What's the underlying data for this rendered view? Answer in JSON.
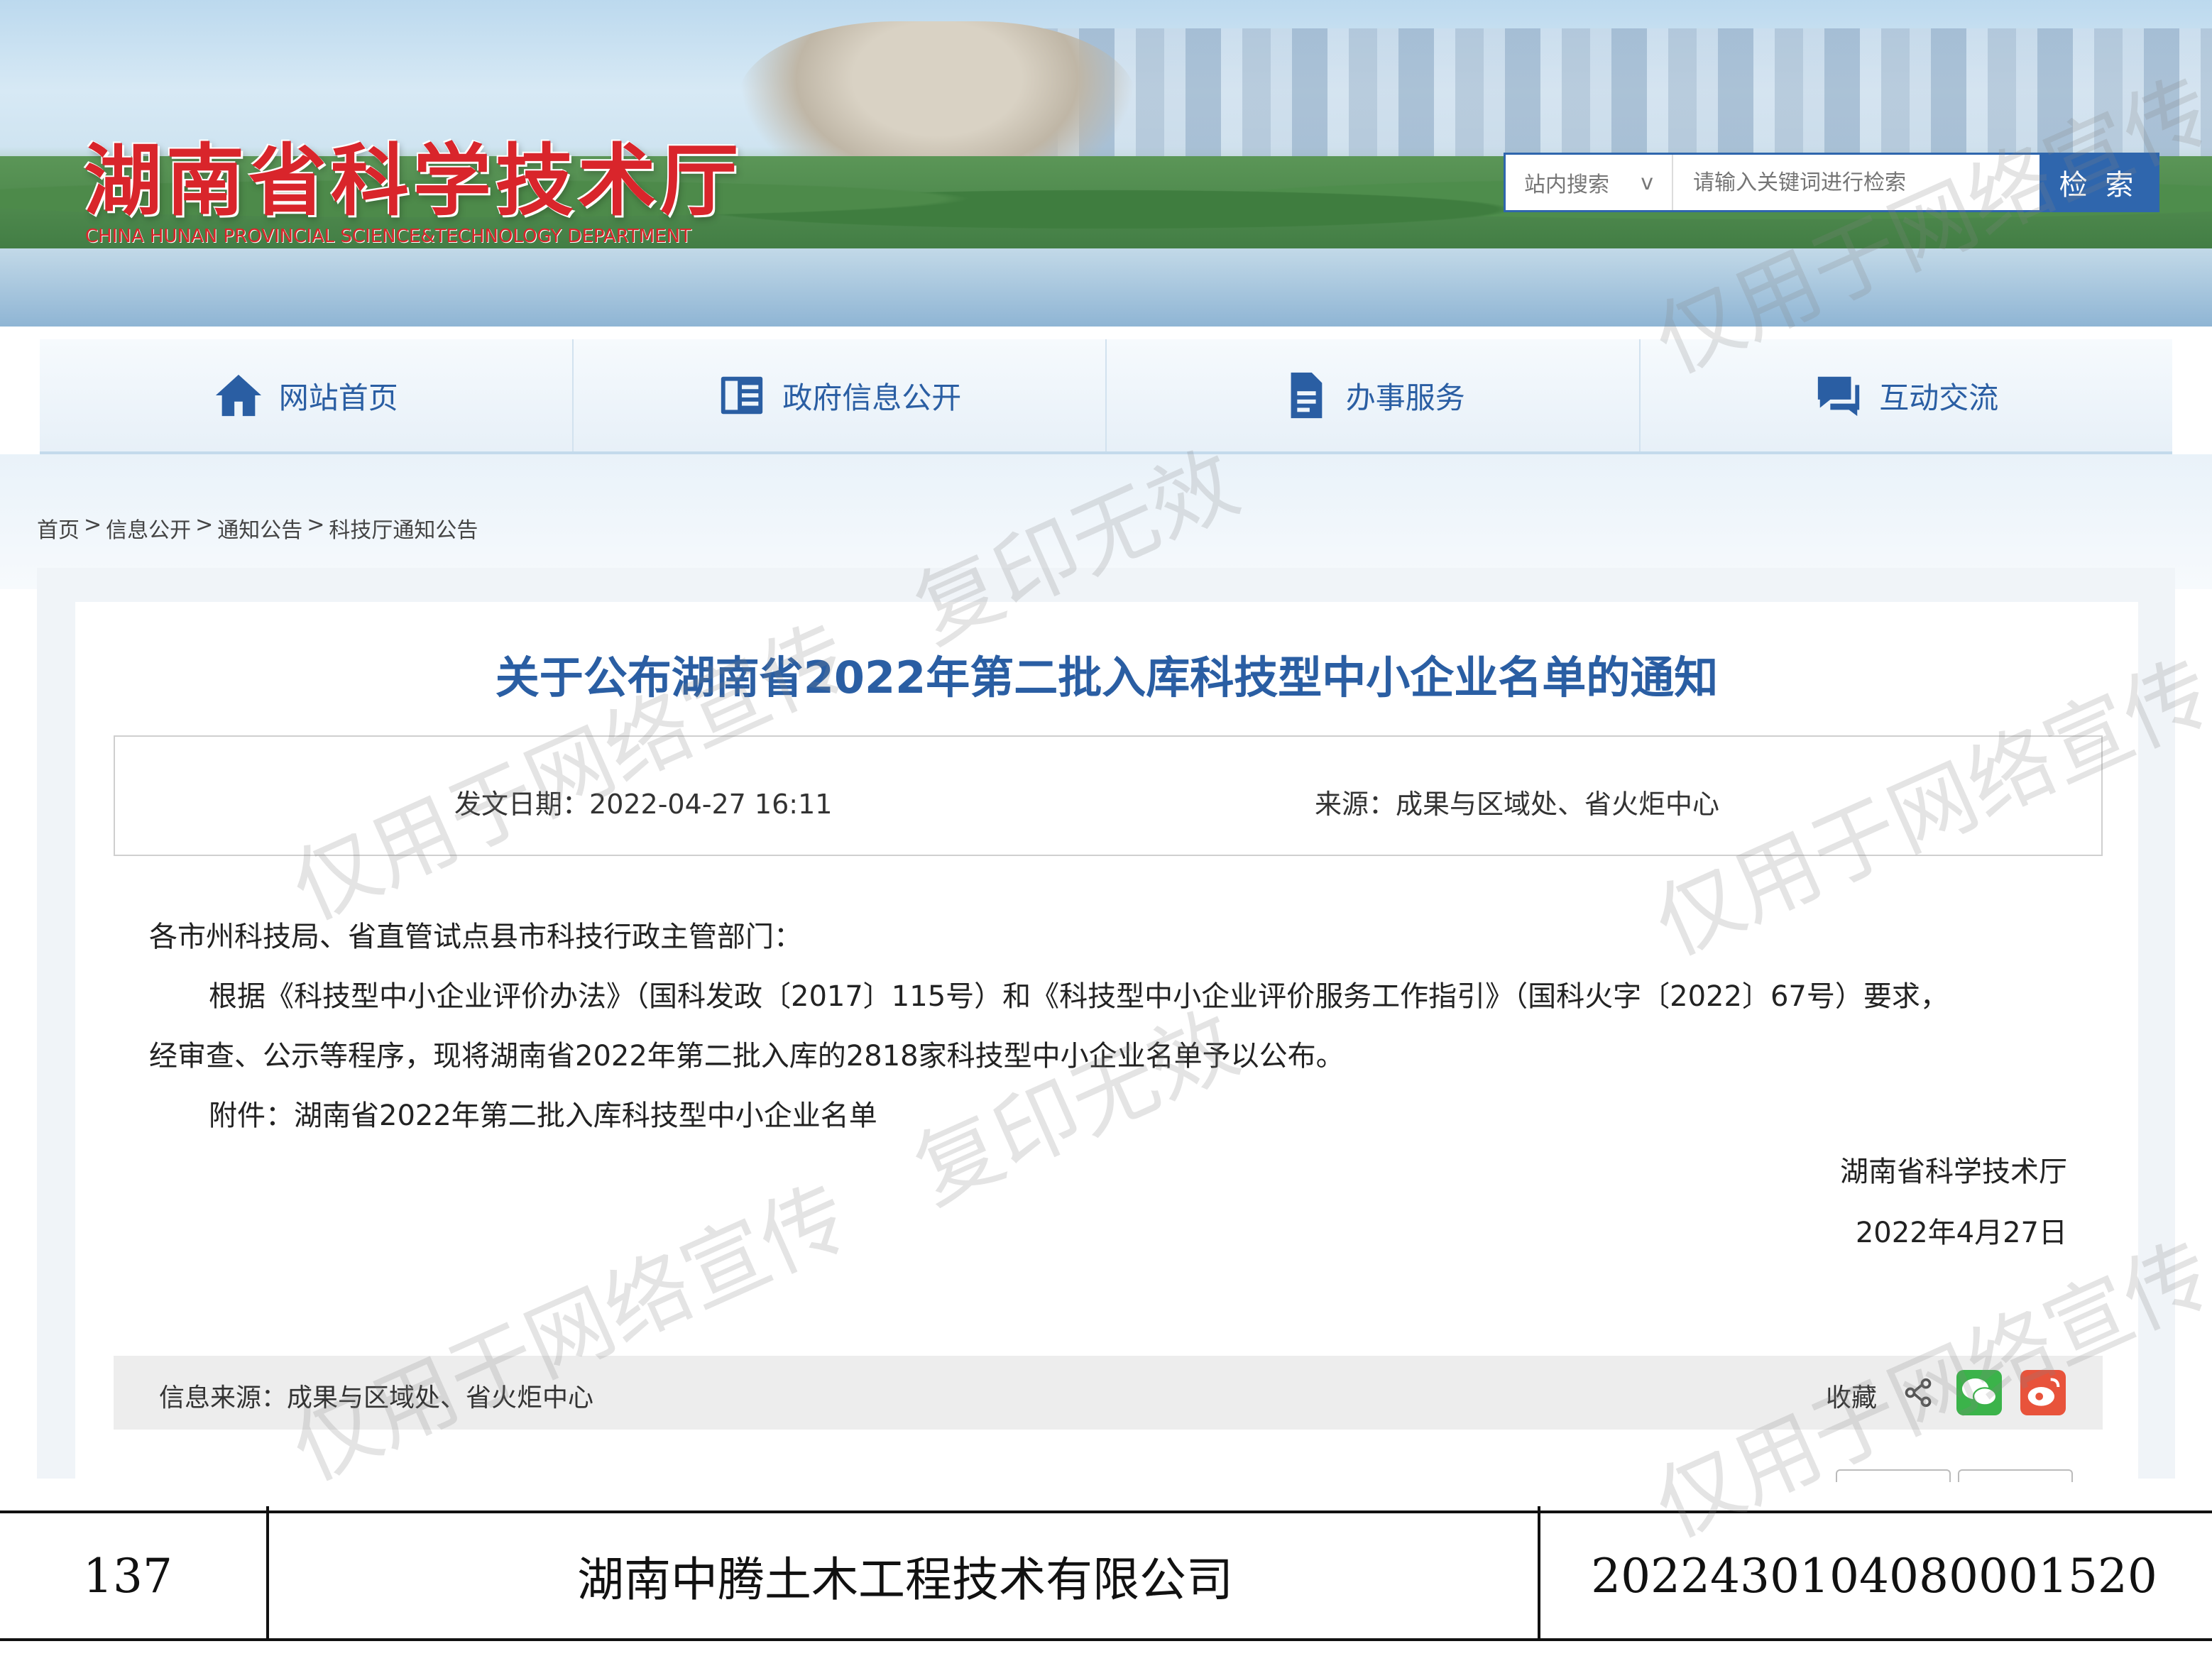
{
  "header": {
    "site_title": "湖南省科学技术厅",
    "site_subtitle": "CHINA HUNAN PROVINCIAL SCIENCE&TECHNOLOGY DEPARTMENT"
  },
  "search": {
    "scope_label": "站内搜索",
    "scope_chevron": "v",
    "placeholder": "请输入关键词进行检索",
    "button_label": "检 索"
  },
  "nav": {
    "items": [
      {
        "label": "网站首页",
        "icon": "home-icon"
      },
      {
        "label": "政府信息公开",
        "icon": "book-icon"
      },
      {
        "label": "办事服务",
        "icon": "document-icon"
      },
      {
        "label": "互动交流",
        "icon": "chat-icon"
      }
    ]
  },
  "breadcrumb": {
    "items": [
      "首页",
      "信息公开",
      "通知公告",
      "科技厅通知公告"
    ],
    "separator": ">"
  },
  "article": {
    "title": "关于公布湖南省2022年第二批入库科技型中小企业名单的通知",
    "date_label": "发文日期：",
    "date_value": "2022-04-27 16:11",
    "source_label": "来源：",
    "source_value": "成果与区域处、省火炬中心",
    "salutation": "各市州科技局、省直管试点县市科技行政主管部门：",
    "paragraph_1": "根据《科技型中小企业评价办法》（国科发政〔2017〕115号）和《科技型中小企业评价服务工作指引》（国科火字〔2022〕67号）要求，",
    "paragraph_1b": "经审查、公示等程序，现将湖南省2022年第二批入库的2818家科技型中小企业名单予以公布。",
    "attachment": "附件：湖南省2022年第二批入库科技型中小企业名单",
    "signer": "湖南省科学技术厅",
    "sign_date": "2022年4月27日"
  },
  "footer": {
    "info_source_label": "信息来源：",
    "info_source_value": "成果与区域处、省火炬中心",
    "favorite_label": "收藏"
  },
  "table_row": {
    "index": "137",
    "company": "湖南中腾土木工程技术有限公司",
    "code": "2022430104080001520"
  },
  "watermark": {
    "text_a": "仅用于网络宣传",
    "text_b": "复印无效"
  },
  "colors": {
    "brand_red": "#d9252b",
    "nav_blue": "#2a5ea3",
    "search_blue": "#2f66ad",
    "wechat_green": "#3bb34a",
    "weibo_red": "#e8533b"
  }
}
